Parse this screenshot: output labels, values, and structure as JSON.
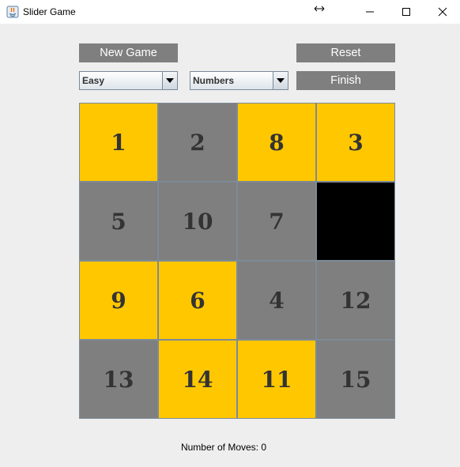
{
  "window": {
    "title": "Slider Game"
  },
  "controls": {
    "new_game_label": "New Game",
    "reset_label": "Reset",
    "finish_label": "Finish",
    "difficulty_selected": "Easy",
    "mode_selected": "Numbers"
  },
  "board": {
    "rows": 4,
    "cols": 4,
    "tiles": [
      {
        "label": "1",
        "color": "#ffc700"
      },
      {
        "label": "2",
        "color": "#7f7f7f"
      },
      {
        "label": "8",
        "color": "#ffc700"
      },
      {
        "label": "3",
        "color": "#ffc700"
      },
      {
        "label": "5",
        "color": "#7f7f7f"
      },
      {
        "label": "10",
        "color": "#7f7f7f"
      },
      {
        "label": "7",
        "color": "#7f7f7f"
      },
      {
        "label": "",
        "color": "#000000"
      },
      {
        "label": "9",
        "color": "#ffc700"
      },
      {
        "label": "6",
        "color": "#ffc700"
      },
      {
        "label": "4",
        "color": "#7f7f7f"
      },
      {
        "label": "12",
        "color": "#7f7f7f"
      },
      {
        "label": "13",
        "color": "#7f7f7f"
      },
      {
        "label": "14",
        "color": "#ffc700"
      },
      {
        "label": "11",
        "color": "#ffc700"
      },
      {
        "label": "15",
        "color": "#7f7f7f"
      }
    ]
  },
  "status": {
    "moves_text": "Number of Moves: 0"
  },
  "colors": {
    "accent_yellow": "#ffc700",
    "tile_gray": "#7f7f7f",
    "empty_tile": "#000000",
    "button_gray": "#7f7f7f",
    "background": "#eeeeee"
  }
}
